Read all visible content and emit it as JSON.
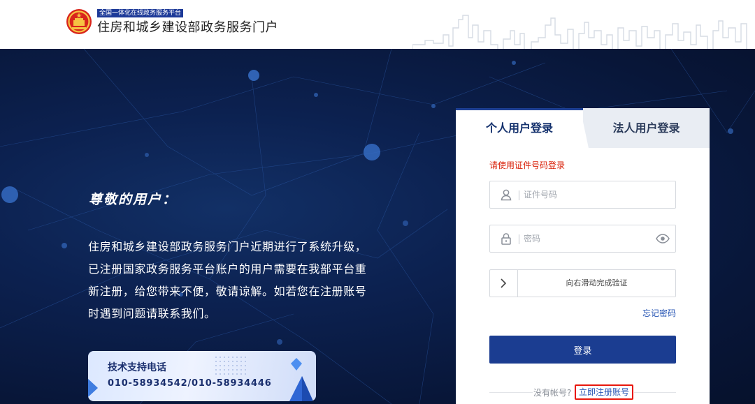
{
  "header": {
    "platform_tag": "全国一体化在线政务服务平台",
    "portal_title": "住房和城乡建设部政务服务门户"
  },
  "hero": {
    "greeting": "尊敬的用户：",
    "notice": "住房和城乡建设部政务服务门户近期进行了系统升级， 已注册国家政务服务平台账户的用户需要在我部平台重新注册，给您带来不便，敬请谅解。如若您在注册账号时遇到问题请联系我们。",
    "support_label": "技术支持电话",
    "support_phone": "010-58934542/010-58934446"
  },
  "login": {
    "tabs": [
      {
        "label": "个人用户登录",
        "active": true
      },
      {
        "label": "法人用户登录",
        "active": false
      }
    ],
    "hint": "请使用证件号码登录",
    "id_field": {
      "placeholder": "证件号码",
      "value": "",
      "icon": "user-icon"
    },
    "password_field": {
      "placeholder": "密码",
      "value": "",
      "icon": "lock-icon",
      "toggle_icon": "eye-icon"
    },
    "slider": {
      "text": "向右滑动完成验证",
      "icon": "chevron-right-icon"
    },
    "forgot_label": "忘记密码",
    "submit_label": "登录",
    "register_prompt": "没有帐号?",
    "register_link": "立即注册账号"
  },
  "colors": {
    "brand_blue": "#1b3d91",
    "hint_red": "#d81e06",
    "highlight_red": "#e8170c",
    "link_blue": "#2453b3",
    "hero_bg": "#0a1a3c"
  }
}
